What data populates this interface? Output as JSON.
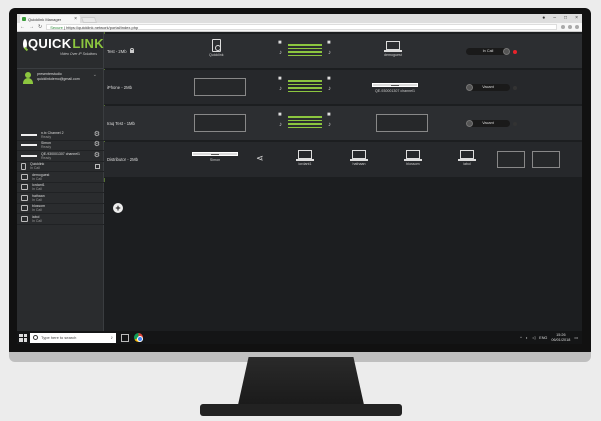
{
  "browser": {
    "tab_title": "Quicklink Manager",
    "url_secure": "Secure",
    "url": "https://quicklink.network/portal/index.php"
  },
  "app": {
    "brand_left": "QUICK",
    "brand_right": "LINK",
    "tagline": "Video Over IP Solutions",
    "user": {
      "name": "presenterstudio",
      "email": "quicklinkdemo@gmail.com"
    }
  },
  "sidebar": {
    "items": [
      {
        "name": "n.tx Channel 2",
        "status": "Ready",
        "icon": "rack-icon",
        "action": "gear-icon"
      },
      {
        "name": "Simon",
        "status": "Ready",
        "icon": "rack-icon",
        "action": "gear-icon"
      },
      {
        "name": "QE-930001307 channel1",
        "status": "Ready",
        "icon": "rack-icon",
        "action": "gear-icon"
      },
      {
        "name": "Quicklink",
        "status": "In Call",
        "icon": "device-icon",
        "action": "grid-icon"
      },
      {
        "name": "demoguest",
        "status": "In Call",
        "icon": "laptop-icon"
      },
      {
        "name": "lordant1",
        "status": "In Call",
        "icon": "laptop-icon"
      },
      {
        "name": "hathaan",
        "status": "In Call",
        "icon": "laptop-icon"
      },
      {
        "name": "blossom",
        "status": "In Call",
        "icon": "laptop-icon"
      },
      {
        "name": "iabol",
        "status": "In Call",
        "icon": "laptop-icon"
      }
    ]
  },
  "rows": [
    {
      "name": "Test - 2Mb",
      "source": "Quicklink",
      "dest": "demoguest",
      "status": "In Call",
      "status_color": "#e8232a"
    },
    {
      "name": "iPhone - 2Mb",
      "dest": "QE-930001307 channel1",
      "status": "Vacant"
    },
    {
      "name": "Iraq Test - 1Mb",
      "dest": "",
      "status": "Vacant"
    },
    {
      "name": "Distributor - 2Mb",
      "source": "Simon",
      "targets": [
        "lordant1",
        "hathaan",
        "blossom",
        "iabol"
      ]
    }
  ],
  "taskbar": {
    "search_placeholder": "Type here to search",
    "lang": "ENG",
    "time": "15:26",
    "date": "06/01/2018"
  },
  "colors": {
    "accent": "#8cc63f",
    "alert": "#e8232a"
  }
}
